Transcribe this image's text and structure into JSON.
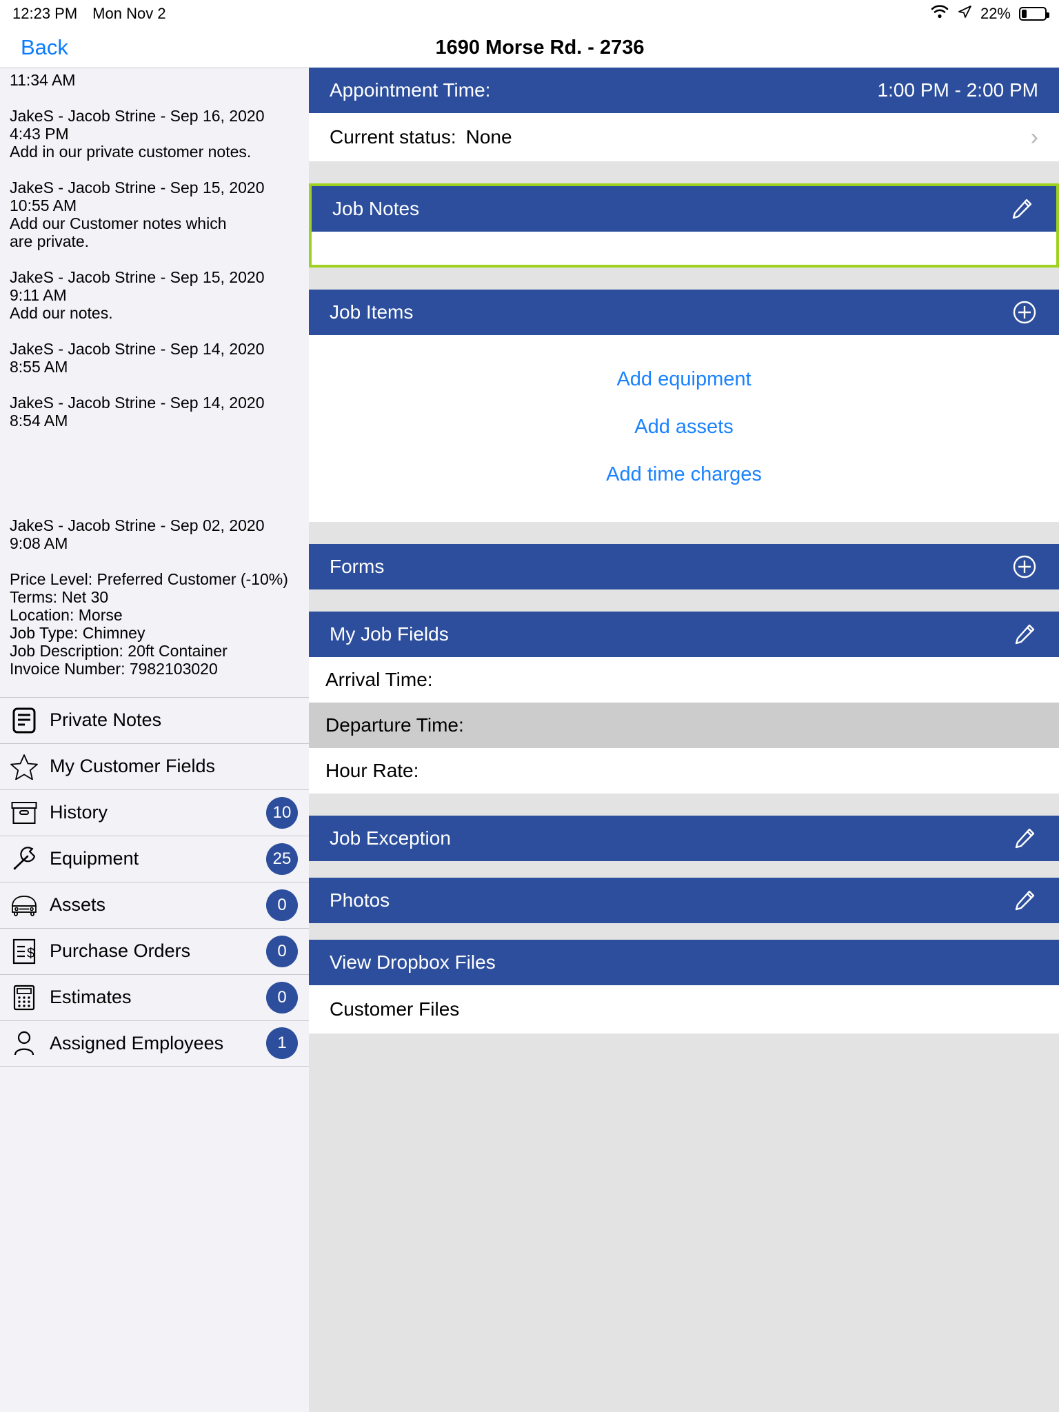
{
  "statusbar": {
    "time": "12:23 PM",
    "date": "Mon Nov 2",
    "battery_pct": "22%",
    "wifi_icon": "wifi-icon",
    "location_icon": "location-arrow-icon",
    "battery_icon": "battery-icon"
  },
  "nav": {
    "back_label": "Back",
    "title": "1690 Morse Rd. - 2736"
  },
  "sidebar": {
    "notes": [
      "11:34 AM",
      "JakeS - Jacob Strine - Sep 16, 2020\n4:43 PM\nAdd in our private customer notes.",
      "JakeS - Jacob Strine - Sep 15, 2020\n10:55 AM\nAdd our Customer notes which\nare private.",
      "JakeS - Jacob Strine - Sep 15, 2020\n9:11 AM\nAdd our notes.",
      "JakeS - Jacob Strine - Sep 14, 2020\n8:55 AM",
      "JakeS - Jacob Strine - Sep 14, 2020\n8:54 AM",
      "",
      "JakeS - Jacob Strine - Sep 02, 2020\n9:08 AM"
    ],
    "meta": "Price Level: Preferred Customer (-10%)\nTerms: Net 30\nLocation: Morse\nJob Type: Chimney\nJob Description: 20ft Container\nInvoice Number: 7982103020",
    "menu": [
      {
        "label": "Private Notes",
        "icon": "notes-document-icon",
        "badge": null
      },
      {
        "label": "My Customer Fields",
        "icon": "star-icon",
        "badge": null
      },
      {
        "label": "History",
        "icon": "archive-box-icon",
        "badge": "10"
      },
      {
        "label": "Equipment",
        "icon": "wrench-icon",
        "badge": "25"
      },
      {
        "label": "Assets",
        "icon": "vehicle-icon",
        "badge": "0"
      },
      {
        "label": "Purchase Orders",
        "icon": "invoice-dollar-icon",
        "badge": "0"
      },
      {
        "label": "Estimates",
        "icon": "calculator-icon",
        "badge": "0"
      },
      {
        "label": "Assigned Employees",
        "icon": "person-icon",
        "badge": "1"
      }
    ]
  },
  "main": {
    "appointment": {
      "label": "Appointment Time:",
      "value": "1:00 PM - 2:00 PM"
    },
    "current_status": {
      "label": "Current status:",
      "value": "None",
      "chevron": "chevron-right-icon"
    },
    "job_notes": {
      "title": "Job Notes",
      "edit_icon": "pencil-icon",
      "body": ""
    },
    "job_items": {
      "title": "Job Items",
      "add_icon": "plus-circle-icon",
      "links": [
        "Add equipment",
        "Add assets",
        "Add time charges"
      ]
    },
    "forms": {
      "title": "Forms",
      "add_icon": "plus-circle-icon"
    },
    "my_job_fields": {
      "title": "My Job Fields",
      "edit_icon": "pencil-icon",
      "fields": [
        "Arrival Time:",
        "Departure Time:",
        "Hour Rate:"
      ]
    },
    "job_exception": {
      "title": "Job Exception",
      "edit_icon": "pencil-icon"
    },
    "photos": {
      "title": "Photos",
      "edit_icon": "pencil-icon"
    },
    "dropbox": {
      "title": "View Dropbox Files",
      "row": "Customer Files"
    }
  },
  "colors": {
    "header_blue": "#2c4e9c",
    "highlight_green": "#9fd220",
    "link_blue": "#1a82ff",
    "back_blue": "#0a7cff"
  }
}
